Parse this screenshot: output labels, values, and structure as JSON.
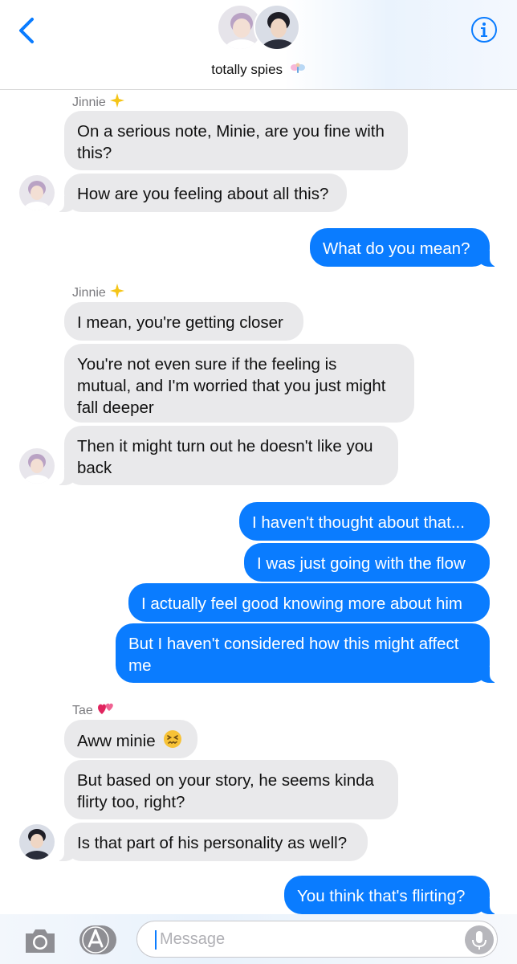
{
  "header": {
    "group_name": "totally spies",
    "colors": {
      "accent": "#0a7cff",
      "incoming": "#e9e9eb"
    }
  },
  "messages": [
    {
      "sender": "Jinnie",
      "text": "On a serious note, Minie, are you fine with",
      "text2": "this?"
    },
    {
      "text": "How are you feeling about all this?"
    },
    {
      "text": "What do you mean?"
    },
    {
      "sender": "Jinnie",
      "text": "I mean, you're getting closer"
    },
    {
      "text": "You're not even sure if the feeling is",
      "text2": "mutual, and I'm worried that you just might",
      "text3": "fall deeper"
    },
    {
      "text": "Then it might turn out he doesn't like you",
      "text2": "back"
    },
    {
      "text": "I haven't thought about that..."
    },
    {
      "text": "I was just going with the flow"
    },
    {
      "text": "I actually feel good knowing more about him"
    },
    {
      "text": "But I haven't considered how this might affect",
      "text2": "me"
    },
    {
      "sender": "Tae",
      "text": "Aww minie"
    },
    {
      "text": "But based on your story, he seems kinda",
      "text2": "flirty too, right?"
    },
    {
      "text": "Is that part of his personality as well?"
    },
    {
      "text": "You think that's flirting?"
    }
  ],
  "composer": {
    "placeholder": "Message"
  }
}
